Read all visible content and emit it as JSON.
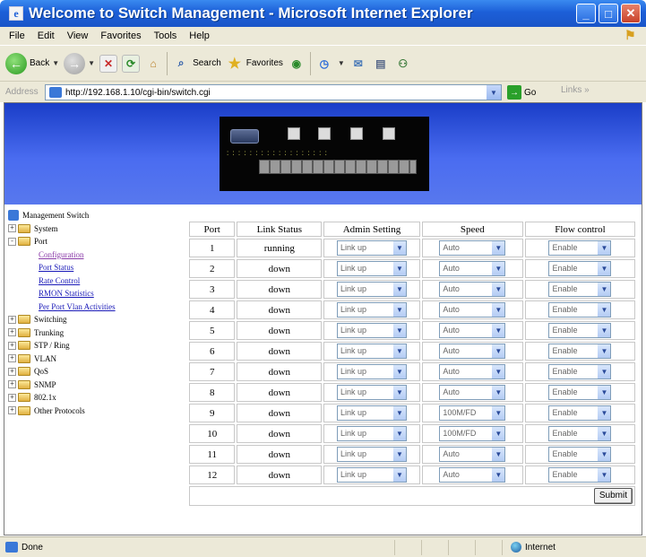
{
  "window": {
    "title": "Welcome to Switch Management - Microsoft Internet Explorer"
  },
  "menu": [
    "File",
    "Edit",
    "View",
    "Favorites",
    "Tools",
    "Help"
  ],
  "toolbar": {
    "back_label": "Back",
    "search_label": "Search",
    "favorites_label": "Favorites"
  },
  "address": {
    "label": "Address",
    "url": "http://192.168.1.10/cgi-bin/switch.cgi",
    "go_label": "Go",
    "links_label": "Links"
  },
  "tree": {
    "root": "Management Switch",
    "items": [
      {
        "label": "System",
        "expander": "+"
      },
      {
        "label": "Port",
        "expander": "-"
      }
    ],
    "port_subitems": [
      "Configuration",
      "Port Status",
      "Rate Control",
      "RMON Statistics",
      "Per Port Vlan Activities"
    ],
    "more_items": [
      {
        "label": "Switching",
        "expander": "+"
      },
      {
        "label": "Trunking",
        "expander": "+"
      },
      {
        "label": "STP / Ring",
        "expander": "+"
      },
      {
        "label": "VLAN",
        "expander": "+"
      },
      {
        "label": "QoS",
        "expander": "+"
      },
      {
        "label": "SNMP",
        "expander": "+"
      },
      {
        "label": "802.1x",
        "expander": "+"
      },
      {
        "label": "Other Protocols",
        "expander": "+"
      }
    ]
  },
  "port_table": {
    "headers": {
      "port": "Port",
      "status": "Link Status",
      "admin": "Admin Setting",
      "speed": "Speed",
      "flow": "Flow control"
    },
    "rows": [
      {
        "port": "1",
        "status": "running",
        "admin": "Link up",
        "speed": "Auto",
        "flow": "Enable"
      },
      {
        "port": "2",
        "status": "down",
        "admin": "Link up",
        "speed": "Auto",
        "flow": "Enable"
      },
      {
        "port": "3",
        "status": "down",
        "admin": "Link up",
        "speed": "Auto",
        "flow": "Enable"
      },
      {
        "port": "4",
        "status": "down",
        "admin": "Link up",
        "speed": "Auto",
        "flow": "Enable"
      },
      {
        "port": "5",
        "status": "down",
        "admin": "Link up",
        "speed": "Auto",
        "flow": "Enable"
      },
      {
        "port": "6",
        "status": "down",
        "admin": "Link up",
        "speed": "Auto",
        "flow": "Enable"
      },
      {
        "port": "7",
        "status": "down",
        "admin": "Link up",
        "speed": "Auto",
        "flow": "Enable"
      },
      {
        "port": "8",
        "status": "down",
        "admin": "Link up",
        "speed": "Auto",
        "flow": "Enable"
      },
      {
        "port": "9",
        "status": "down",
        "admin": "Link up",
        "speed": "100M/FD",
        "flow": "Enable"
      },
      {
        "port": "10",
        "status": "down",
        "admin": "Link up",
        "speed": "100M/FD",
        "flow": "Enable"
      },
      {
        "port": "11",
        "status": "down",
        "admin": "Link up",
        "speed": "Auto",
        "flow": "Enable"
      },
      {
        "port": "12",
        "status": "down",
        "admin": "Link up",
        "speed": "Auto",
        "flow": "Enable"
      }
    ],
    "submit_label": "Submit"
  },
  "status": {
    "left": "Done",
    "zone": "Internet"
  }
}
